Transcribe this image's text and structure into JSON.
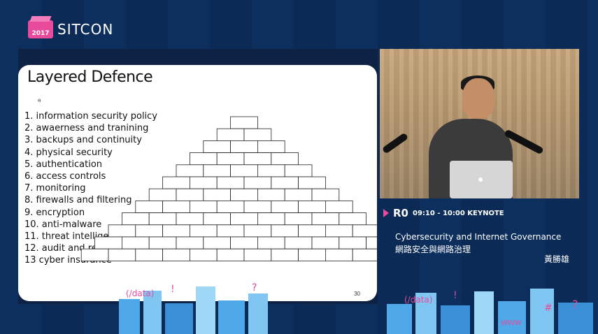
{
  "logo": {
    "year": "2017",
    "name": "SITCON"
  },
  "slide": {
    "title": "Layered Defence",
    "mark": "ɵ",
    "items": [
      "1. information security policy",
      "2. awaerness and tranining",
      "3. backups and continuity",
      "4. physical security",
      "5. authentication",
      "6. access controls",
      "7. monitoring",
      "8. firewalls and filtering",
      "9. encryption",
      "10. anti-malware",
      "11. threat intelligence",
      "12. audit and review",
      "13 cyber insurance"
    ],
    "page_number": "30",
    "pyramid_rows": [
      1,
      2,
      3,
      4,
      5,
      6,
      7,
      8,
      9,
      10,
      11,
      12
    ]
  },
  "session": {
    "room": "R0",
    "time": "09:10 - 10:00 KEYNOTE",
    "title_en": "Cybersecurity and Internet Governance",
    "title_zh": "網路安全與網路治理",
    "speaker": "黃勝雄"
  },
  "colors": {
    "background": "#0b2a56",
    "accent": "#e84a9c",
    "slide": "#ffffff"
  },
  "city_decor_text": [
    "(/data)",
    "!",
    "@",
    "#",
    "?",
    "WWW"
  ]
}
